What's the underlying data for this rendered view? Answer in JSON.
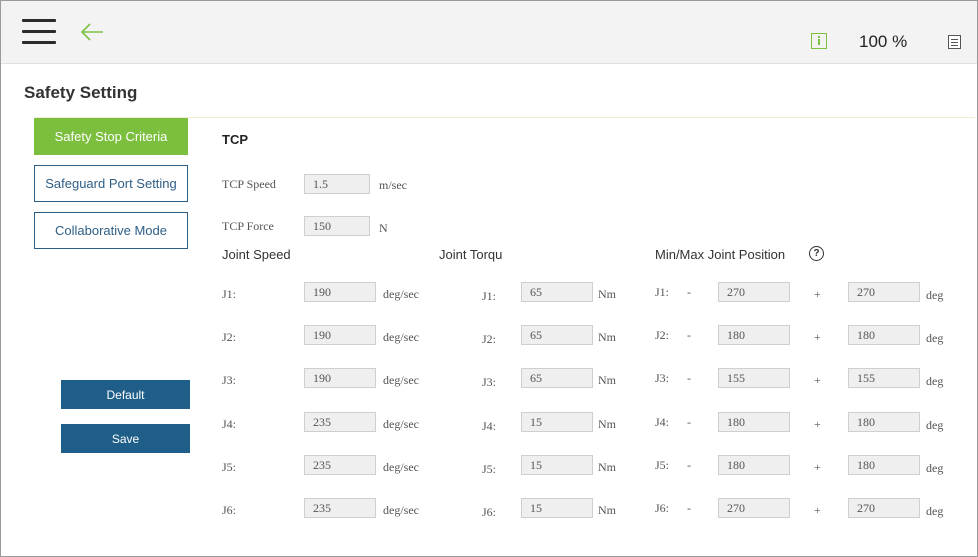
{
  "header": {
    "zoom": "100 %",
    "icons": {
      "menu": "hamburger-menu-icon",
      "back": "back-arrow-icon",
      "info": "info-icon",
      "document": "document-icon"
    },
    "accent_color": "#7cc142"
  },
  "page": {
    "title": "Safety Setting"
  },
  "sidebar": {
    "items": [
      {
        "label": "Safety Stop Criteria",
        "active": true
      },
      {
        "label": "Safeguard Port Setting",
        "active": false
      },
      {
        "label": "Collaborative Mode",
        "active": false
      }
    ],
    "default_label": "Default",
    "save_label": "Save"
  },
  "tcp": {
    "heading": "TCP",
    "speed": {
      "label": "TCP Speed",
      "value": "1.5",
      "unit": "m/sec"
    },
    "force": {
      "label": "TCP Force",
      "value": "150",
      "unit": "N"
    }
  },
  "joint_speed": {
    "heading": "Joint Speed",
    "unit": "deg/sec",
    "rows": [
      {
        "label": "J1:",
        "value": "190"
      },
      {
        "label": "J2:",
        "value": "190"
      },
      {
        "label": "J3:",
        "value": "190"
      },
      {
        "label": "J4:",
        "value": "235"
      },
      {
        "label": "J5:",
        "value": "235"
      },
      {
        "label": "J6:",
        "value": "235"
      }
    ]
  },
  "joint_torque": {
    "heading": "Joint Torqu",
    "unit": "Nm",
    "rows": [
      {
        "label": "J1:",
        "value": "65"
      },
      {
        "label": "J2:",
        "value": "65"
      },
      {
        "label": "J3:",
        "value": "65"
      },
      {
        "label": "J4:",
        "value": "15"
      },
      {
        "label": "J5:",
        "value": "15"
      },
      {
        "label": "J6:",
        "value": "15"
      }
    ]
  },
  "joint_position": {
    "heading": "Min/Max Joint Position",
    "help_glyph": "?",
    "minus": "-",
    "plus": "+",
    "unit": "deg",
    "rows": [
      {
        "label": "J1:",
        "min": "270",
        "max": "270"
      },
      {
        "label": "J2:",
        "min": "180",
        "max": "180"
      },
      {
        "label": "J3:",
        "min": "155",
        "max": "155"
      },
      {
        "label": "J4:",
        "min": "180",
        "max": "180"
      },
      {
        "label": "J5:",
        "min": "180",
        "max": "180"
      },
      {
        "label": "J6:",
        "min": "270",
        "max": "270"
      }
    ]
  },
  "colors": {
    "active": "#7cbf3f",
    "primary": "#1f5e89",
    "outline": "#2d5e86"
  }
}
